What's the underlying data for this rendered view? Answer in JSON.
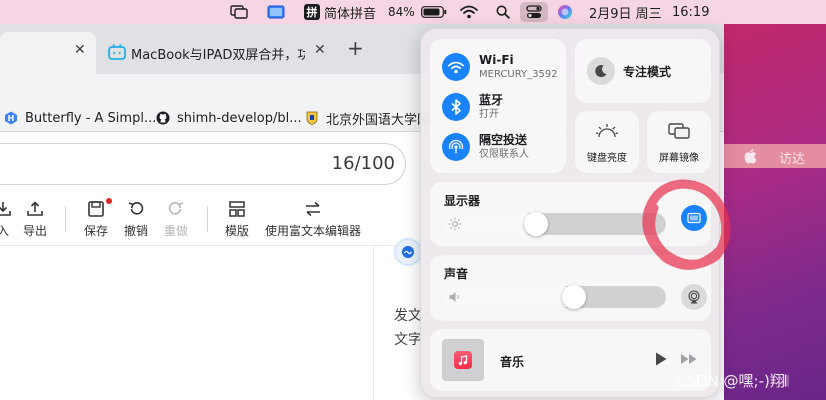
{
  "menubar": {
    "input_method": "简体拼音",
    "input_badge": "拼",
    "battery_percent": "84%",
    "date": "2月9日 周三",
    "time": "16:19"
  },
  "browser": {
    "tabs": [
      {
        "title": "",
        "active": true
      },
      {
        "title": "MacBook与IPAD双屏合并，功力",
        "active": false
      }
    ],
    "new_tab_label": "+",
    "bookmarks": [
      {
        "label": "Butterfly - A Simpl...",
        "icon": "butterfly-icon"
      },
      {
        "label": "shimh-develop/bl...",
        "icon": "github-icon"
      },
      {
        "label": "北京外国语大学网",
        "icon": "bfsu-icon"
      }
    ]
  },
  "editor": {
    "title_counter": "16/100",
    "toolbar": [
      {
        "label": "入",
        "icon": "import-icon",
        "enabled": true
      },
      {
        "label": "导出",
        "icon": "export-icon",
        "enabled": true
      },
      {
        "label": "保存",
        "icon": "save-icon",
        "enabled": true,
        "has_dot": true
      },
      {
        "label": "撤销",
        "icon": "undo-icon",
        "enabled": true
      },
      {
        "label": "重做",
        "icon": "redo-icon",
        "enabled": false
      },
      {
        "label": "模版",
        "icon": "template-icon",
        "enabled": true
      },
      {
        "label": "使用富文本编辑器",
        "icon": "switch-editor-icon",
        "enabled": true
      }
    ],
    "side_text_1": "发文",
    "side_text_2": "文字"
  },
  "control_center": {
    "wifi": {
      "name": "Wi-Fi",
      "network": "MERCURY_3592"
    },
    "bluetooth": {
      "name": "蓝牙",
      "status": "打开"
    },
    "airdrop": {
      "name": "隔空投送",
      "status": "仅限联系人"
    },
    "focus": {
      "label": "专注模式"
    },
    "keyboard_brightness": {
      "label": "键盘亮度"
    },
    "screen_mirroring": {
      "label": "屏幕镜像"
    },
    "display": {
      "label": "显示器",
      "brightness": 0.41
    },
    "sound": {
      "label": "声音",
      "volume": 0.6
    },
    "music": {
      "label": "音乐"
    }
  },
  "desktop": {
    "visit_label": "访达"
  },
  "watermark": "CSDN @嘿;-)翔𝄃",
  "colors": {
    "accent": "#1a82fb",
    "annotation": "#e8324f",
    "menubar": "#f6d6e4"
  }
}
